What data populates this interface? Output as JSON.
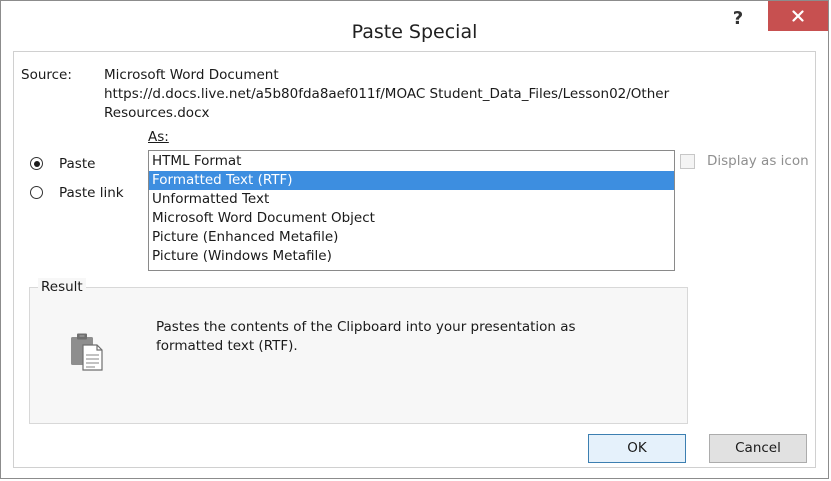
{
  "dialog": {
    "title": "Paste Special",
    "help_label": "?",
    "close_label": "×"
  },
  "source": {
    "label": "Source:",
    "line1": "Microsoft Word Document",
    "line2": "https://d.docs.live.net/a5b80fda8aef011f/MOAC Student_Data_Files/Lesson02/Other",
    "line3": "Resources.docx"
  },
  "as_label": "As:",
  "paste_options": {
    "paste": "Paste",
    "paste_link": "Paste link",
    "selected": "Paste"
  },
  "formats": [
    "HTML Format",
    "Formatted Text (RTF)",
    "Unformatted Text",
    "Microsoft Word Document Object",
    "Picture (Enhanced Metafile)",
    "Picture (Windows Metafile)"
  ],
  "selected_format": "Formatted Text (RTF)",
  "display_as_icon": {
    "label": "Display as icon",
    "checked": false,
    "enabled": false
  },
  "result": {
    "label": "Result",
    "text": "Pastes the contents of the Clipboard into your presentation as\nformatted text (RTF).",
    "icon": "clipboard-paste-icon"
  },
  "buttons": {
    "ok": "OK",
    "cancel": "Cancel"
  },
  "colors": {
    "close_button": "#c75050",
    "selection": "#3d8ee0"
  }
}
